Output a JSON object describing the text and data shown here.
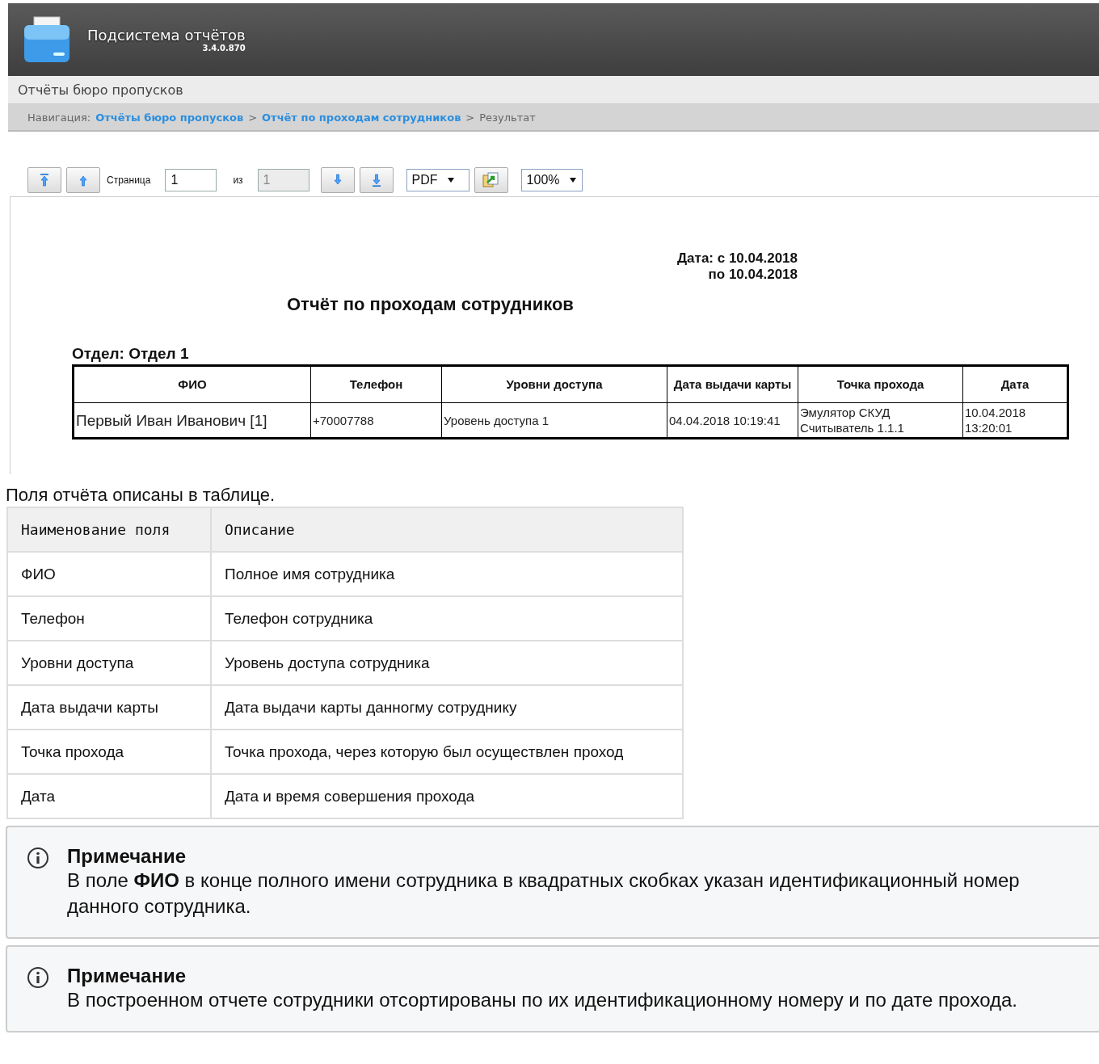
{
  "header": {
    "title": "Подсистема отчётов",
    "version": "3.4.0.870"
  },
  "section_title": "Отчёты бюро пропусков",
  "breadcrumb": {
    "label": "Навигация:",
    "links": [
      "Отчёты бюро пропусков",
      "Отчёт по проходам сотрудников"
    ],
    "separator": ">",
    "current": "Результат"
  },
  "toolbar": {
    "page_label": "Страница",
    "page_value": "1",
    "of_label": "из",
    "total": {
      "value": "1",
      "disabled": true
    },
    "format": "PDF",
    "zoom": "100%"
  },
  "report": {
    "date_from": "Дата: с 10.04.2018",
    "date_to": "по 10.04.2018",
    "title": "Отчёт по проходам сотрудников",
    "department": "Отдел: Отдел 1",
    "columns": [
      "ФИО",
      "Телефон",
      "Уровни доступа",
      "Дата выдачи карты",
      "Точка прохода",
      "Дата"
    ],
    "rows": [
      [
        "Первый Иван Иванович [1]",
        "+70007788",
        "Уровень доступа 1",
        "04.04.2018 10:19:41",
        "Эмулятор СКУД Считыватель 1.1.1",
        "10.04.2018 13:20:01"
      ]
    ]
  },
  "intro": "Поля отчёта описаны в таблице.",
  "fields_table": {
    "columns": [
      "Наименование поля",
      "Описание"
    ],
    "rows": [
      [
        "ФИО",
        "Полное имя сотрудника"
      ],
      [
        "Телефон",
        "Телефон сотрудника"
      ],
      [
        "Уровни доступа",
        "Уровень доступа сотрудника"
      ],
      [
        "Дата выдачи карты",
        "Дата выдачи карты данногму сотруднику"
      ],
      [
        "Точка прохода",
        "Точка прохода, через которую был осуществлен проход"
      ],
      [
        "Дата",
        "Дата и время совершения прохода"
      ]
    ]
  },
  "notes": [
    {
      "title": "Примечание",
      "text": "В поле **ФИО** в конце полного имени сотрудника в квадратных скобках указан идентификационный номер данного сотрудника."
    },
    {
      "title": "Примечание",
      "text": "В построенном отчете сотрудники отсортированы по их идентификационному номеру и по дате прохода."
    }
  ]
}
